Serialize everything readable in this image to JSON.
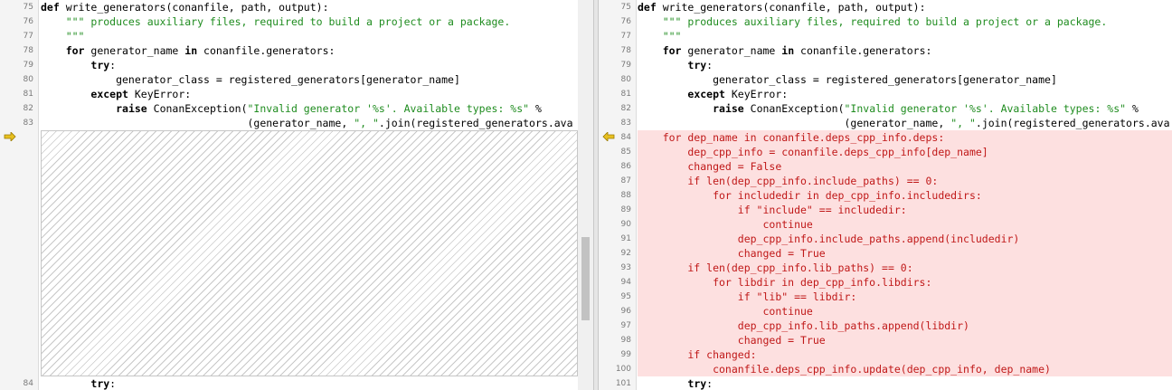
{
  "left": {
    "lines": [
      {
        "num": "75",
        "parts": [
          {
            "t": "def",
            "c": "kw"
          },
          {
            "t": " write_generators(conanfile, path, output):"
          }
        ]
      },
      {
        "num": "76",
        "parts": [
          {
            "t": "    \"\"\" produces auxiliary files, required to build a project or a package.",
            "c": "str"
          }
        ]
      },
      {
        "num": "77",
        "parts": [
          {
            "t": "    \"\"\"",
            "c": "str"
          }
        ]
      },
      {
        "num": "78",
        "parts": [
          {
            "t": "    "
          },
          {
            "t": "for",
            "c": "kw"
          },
          {
            "t": " generator_name "
          },
          {
            "t": "in",
            "c": "kw"
          },
          {
            "t": " conanfile.generators:"
          }
        ]
      },
      {
        "num": "79",
        "parts": [
          {
            "t": "        "
          },
          {
            "t": "try",
            "c": "kw"
          },
          {
            "t": ":"
          }
        ]
      },
      {
        "num": "80",
        "parts": [
          {
            "t": "            generator_class = registered_generators[generator_name]"
          }
        ]
      },
      {
        "num": "81",
        "parts": [
          {
            "t": "        "
          },
          {
            "t": "except",
            "c": "kw"
          },
          {
            "t": " KeyError:"
          }
        ]
      },
      {
        "num": "82",
        "parts": [
          {
            "t": "            "
          },
          {
            "t": "raise",
            "c": "kw"
          },
          {
            "t": " ConanException("
          },
          {
            "t": "\"Invalid generator '%s'. Available types: %s\"",
            "c": "str"
          },
          {
            "t": " %"
          }
        ]
      },
      {
        "num": "83",
        "parts": [
          {
            "t": "                                 (generator_name, "
          },
          {
            "t": "\", \"",
            "c": "str"
          },
          {
            "t": ".join(registered_generators.ava"
          }
        ]
      }
    ],
    "after_line": {
      "num": "84",
      "parts": [
        {
          "t": "        "
        },
        {
          "t": "try",
          "c": "kw"
        },
        {
          "t": ":"
        }
      ]
    }
  },
  "right": {
    "lines": [
      {
        "num": "75",
        "parts": [
          {
            "t": "def",
            "c": "kw"
          },
          {
            "t": " write_generators(conanfile, path, output):"
          }
        ]
      },
      {
        "num": "76",
        "parts": [
          {
            "t": "    \"\"\" produces auxiliary files, required to build a project or a package.",
            "c": "str"
          }
        ]
      },
      {
        "num": "77",
        "parts": [
          {
            "t": "    \"\"\"",
            "c": "str"
          }
        ]
      },
      {
        "num": "78",
        "parts": [
          {
            "t": "    "
          },
          {
            "t": "for",
            "c": "kw"
          },
          {
            "t": " generator_name "
          },
          {
            "t": "in",
            "c": "kw"
          },
          {
            "t": " conanfile.generators:"
          }
        ]
      },
      {
        "num": "79",
        "parts": [
          {
            "t": "        "
          },
          {
            "t": "try",
            "c": "kw"
          },
          {
            "t": ":"
          }
        ]
      },
      {
        "num": "80",
        "parts": [
          {
            "t": "            generator_class = registered_generators[generator_name]"
          }
        ]
      },
      {
        "num": "81",
        "parts": [
          {
            "t": "        "
          },
          {
            "t": "except",
            "c": "kw"
          },
          {
            "t": " KeyError:"
          }
        ]
      },
      {
        "num": "82",
        "parts": [
          {
            "t": "            "
          },
          {
            "t": "raise",
            "c": "kw"
          },
          {
            "t": " ConanException("
          },
          {
            "t": "\"Invalid generator '%s'. Available types: %s\"",
            "c": "str"
          },
          {
            "t": " %"
          }
        ]
      },
      {
        "num": "83",
        "parts": [
          {
            "t": "                                 (generator_name, "
          },
          {
            "t": "\", \"",
            "c": "str"
          },
          {
            "t": ".join(registered_generators.ava"
          }
        ]
      }
    ],
    "added_lines": [
      {
        "num": "84",
        "text": "    for dep_name in conanfile.deps_cpp_info.deps:"
      },
      {
        "num": "85",
        "text": "        dep_cpp_info = conanfile.deps_cpp_info[dep_name]"
      },
      {
        "num": "86",
        "text": "        changed = False"
      },
      {
        "num": "87",
        "text": "        if len(dep_cpp_info.include_paths) == 0:"
      },
      {
        "num": "88",
        "text": "            for includedir in dep_cpp_info.includedirs:"
      },
      {
        "num": "89",
        "text": "                if \"include\" == includedir:"
      },
      {
        "num": "90",
        "text": "                    continue"
      },
      {
        "num": "91",
        "text": "                dep_cpp_info.include_paths.append(includedir)"
      },
      {
        "num": "92",
        "text": "                changed = True"
      },
      {
        "num": "93",
        "text": "        if len(dep_cpp_info.lib_paths) == 0:"
      },
      {
        "num": "94",
        "text": "            for libdir in dep_cpp_info.libdirs:"
      },
      {
        "num": "95",
        "text": "                if \"lib\" == libdir:"
      },
      {
        "num": "96",
        "text": "                    continue"
      },
      {
        "num": "97",
        "text": "                dep_cpp_info.lib_paths.append(libdir)"
      },
      {
        "num": "98",
        "text": "                changed = True"
      },
      {
        "num": "99",
        "text": "        if changed:"
      },
      {
        "num": "100",
        "text": "            conanfile.deps_cpp_info.update(dep_cpp_info, dep_name)"
      }
    ],
    "after_line": {
      "num": "101",
      "parts": [
        {
          "t": "        "
        },
        {
          "t": "try",
          "c": "kw"
        },
        {
          "t": ":"
        }
      ]
    }
  },
  "colors": {
    "added_bg": "#fde0e0",
    "added_text": "#c01818",
    "string": "#1f8c1f",
    "marker_arrow": "#e8c020"
  },
  "icons": {
    "left_marker": "arrow-right-icon",
    "right_marker": "arrow-left-icon"
  }
}
